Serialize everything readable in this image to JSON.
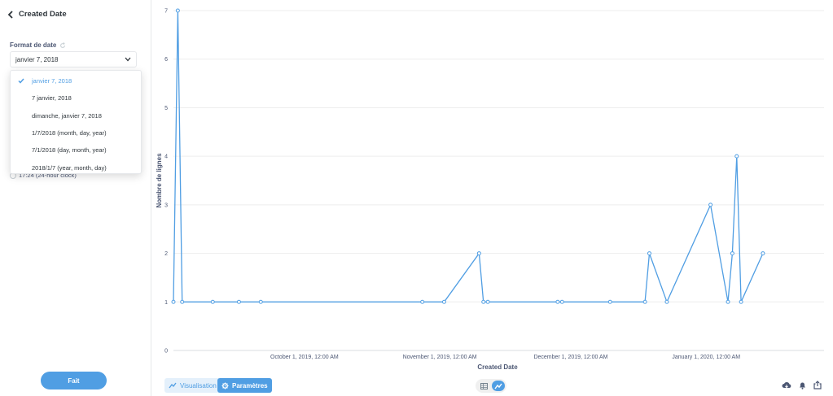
{
  "sidebar": {
    "title": "Created Date",
    "format_label": "Format de date",
    "selected_format": "janvier 7, 2018",
    "ghost_clock_label": "17:24 (24-hour clock)",
    "options": [
      {
        "label": "janvier 7, 2018",
        "selected": true
      },
      {
        "label": "7 janvier, 2018",
        "selected": false
      },
      {
        "label": "dimanche, janvier 7, 2018",
        "selected": false
      },
      {
        "label": "1/7/2018 (month, day, year)",
        "selected": false
      },
      {
        "label": "7/1/2018 (day, month, year)",
        "selected": false
      },
      {
        "label": "2018/1/7 (year, month, day)",
        "selected": false
      }
    ],
    "done_label": "Fait"
  },
  "footer": {
    "visualization_label": "Visualisation",
    "settings_label": "Paramètres"
  },
  "colors": {
    "accent": "#509ee3",
    "text": "#2e353b",
    "muted": "#4c5773",
    "grid": "#ededed"
  },
  "chart_data": {
    "type": "line",
    "xlabel": "Created Date",
    "ylabel": "Nombre de lignes",
    "ylim": [
      0,
      7
    ],
    "yticks": [
      0,
      1,
      2,
      3,
      4,
      5,
      6,
      7
    ],
    "x_domain": [
      "2019-09-01",
      "2020-01-28"
    ],
    "xticks": [
      {
        "date": "2019-10-01",
        "label": "October 1, 2019, 12:00 AM"
      },
      {
        "date": "2019-11-01",
        "label": "November 1, 2019, 12:00 AM"
      },
      {
        "date": "2019-12-01",
        "label": "December 1, 2019, 12:00 AM"
      },
      {
        "date": "2020-01-01",
        "label": "January 1, 2020, 12:00 AM"
      }
    ],
    "grid": "horizontal",
    "series": [
      {
        "color": "#509ee3",
        "points": [
          {
            "x": "2019-09-01",
            "y": 1
          },
          {
            "x": "2019-09-02",
            "y": 7
          },
          {
            "x": "2019-09-03",
            "y": 1
          },
          {
            "x": "2019-09-10",
            "y": 1
          },
          {
            "x": "2019-09-16",
            "y": 1
          },
          {
            "x": "2019-09-21",
            "y": 1
          },
          {
            "x": "2019-10-28",
            "y": 1
          },
          {
            "x": "2019-11-02",
            "y": 1
          },
          {
            "x": "2019-11-10",
            "y": 2
          },
          {
            "x": "2019-11-11",
            "y": 1
          },
          {
            "x": "2019-11-12",
            "y": 1
          },
          {
            "x": "2019-11-28",
            "y": 1
          },
          {
            "x": "2019-11-29",
            "y": 1
          },
          {
            "x": "2019-12-10",
            "y": 1
          },
          {
            "x": "2019-12-18",
            "y": 1
          },
          {
            "x": "2019-12-19",
            "y": 2
          },
          {
            "x": "2019-12-23",
            "y": 1
          },
          {
            "x": "2020-01-02",
            "y": 3
          },
          {
            "x": "2020-01-06",
            "y": 1
          },
          {
            "x": "2020-01-07",
            "y": 2
          },
          {
            "x": "2020-01-08",
            "y": 4
          },
          {
            "x": "2020-01-09",
            "y": 1
          },
          {
            "x": "2020-01-14",
            "y": 2
          }
        ]
      }
    ]
  }
}
